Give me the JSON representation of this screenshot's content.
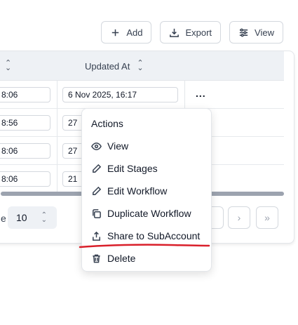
{
  "toolbar": {
    "add_label": "Add",
    "export_label": "Export",
    "view_label": "View"
  },
  "table": {
    "columns": [
      "",
      "Updated At"
    ],
    "rows": [
      {
        "prev_partial": "8:06",
        "updated": "6 Nov 2025, 16:17"
      },
      {
        "prev_partial": "8:56",
        "updated": "27"
      },
      {
        "prev_partial": "8:06",
        "updated": "27"
      },
      {
        "prev_partial": "8:06",
        "updated": "21"
      }
    ],
    "row_action": "..."
  },
  "pager": {
    "label_partial": "e",
    "page_size": "10"
  },
  "menu": {
    "title": "Actions",
    "items": [
      {
        "label": "View",
        "icon": "eye-icon"
      },
      {
        "label": "Edit Stages",
        "icon": "pencil-icon"
      },
      {
        "label": "Edit Workflow",
        "icon": "pencil-icon"
      },
      {
        "label": "Duplicate Workflow",
        "icon": "copy-icon"
      },
      {
        "label": "Share to SubAccount",
        "icon": "share-icon"
      },
      {
        "label": "Delete",
        "icon": "trash-icon"
      }
    ]
  },
  "annotation_color": "#d91f2a"
}
